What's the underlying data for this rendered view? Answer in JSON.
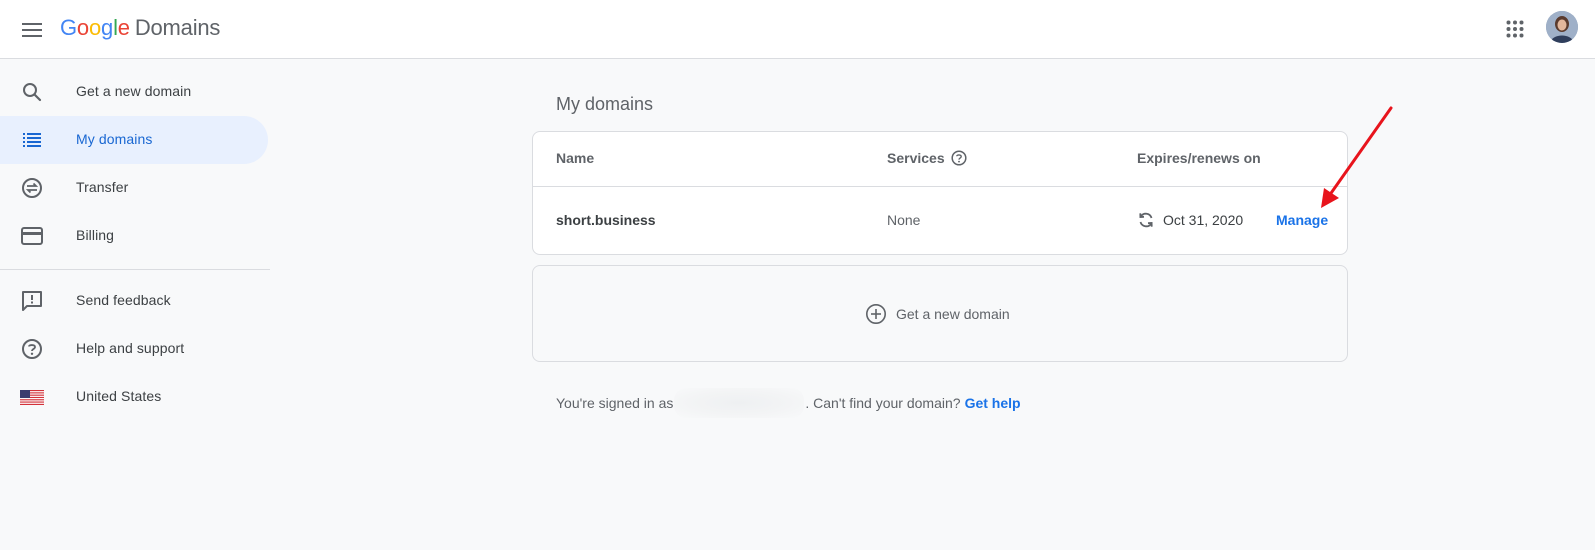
{
  "header": {
    "logo_google": [
      "G",
      "o",
      "o",
      "g",
      "l",
      "e"
    ],
    "product_name": "Domains"
  },
  "sidebar": {
    "items": [
      {
        "label": "Get a new domain",
        "icon": "search-icon"
      },
      {
        "label": "My domains",
        "icon": "list-icon",
        "active": true
      },
      {
        "label": "Transfer",
        "icon": "transfer-icon"
      },
      {
        "label": "Billing",
        "icon": "credit-card-icon"
      },
      {
        "label": "Send feedback",
        "icon": "feedback-icon"
      },
      {
        "label": "Help and support",
        "icon": "help-icon"
      },
      {
        "label": "United States",
        "icon": "us-flag-icon"
      }
    ]
  },
  "main": {
    "title": "My domains",
    "table": {
      "headers": {
        "name": "Name",
        "services": "Services",
        "expires": "Expires/renews on"
      },
      "rows": [
        {
          "name": "short.business",
          "services": "None",
          "expires": "Oct 31, 2020",
          "action": "Manage"
        }
      ]
    },
    "new_domain_label": "Get a new domain",
    "footer": {
      "signed_in_prefix": "You're signed in as",
      "cant_find": ". Can't find your domain?",
      "help_link": "Get help"
    }
  },
  "colors": {
    "accent": "#1a73e8",
    "active_bg": "#e8f0fe",
    "annotation": "#e8141c"
  }
}
